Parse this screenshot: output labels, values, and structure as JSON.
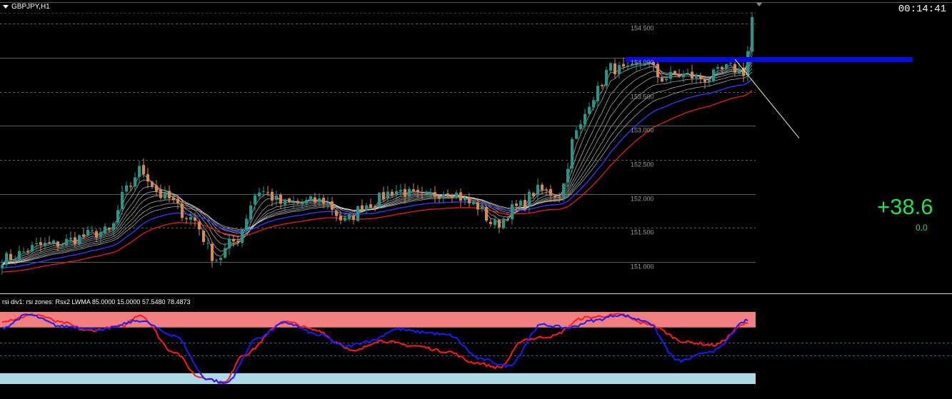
{
  "header": {
    "symbol": "GBPJPY,H1",
    "clock": "00:14:41"
  },
  "panel": {
    "value_big": "+38.6",
    "value_small": "0.0"
  },
  "subwindow": {
    "label": "rsi div1: rsi zones: Rsx2 LWMA 85.0000 15.0000 57.5480 78.4873"
  },
  "colors": {
    "background": "#000000",
    "bull": "#1e9a8a",
    "bear": "#d88a4e",
    "ma_red": "#e02020",
    "ma_blue": "#3a3aff",
    "resistance": "#0a0ae6",
    "upper_zone": "#f08080",
    "lower_zone": "#add8e6",
    "rsi_red": "#ff1a1a",
    "rsi_blue": "#1a1aff",
    "value_green": "#22e04e"
  },
  "chart_data": [
    {
      "type": "candlestick",
      "title": "GBPJPY,H1",
      "y_ticks": [
        "154.500",
        "154.000",
        "153.500",
        "153.000",
        "152.500",
        "152.000",
        "151.500",
        "151.000"
      ],
      "ylim": [
        150.55,
        154.85
      ],
      "n_bars": 176,
      "close_anchors": [
        [
          0,
          151.05
        ],
        [
          10,
          151.25
        ],
        [
          25,
          151.45
        ],
        [
          29,
          152.05
        ],
        [
          32,
          152.35
        ],
        [
          38,
          151.95
        ],
        [
          44,
          151.65
        ],
        [
          50,
          151.05
        ],
        [
          54,
          151.3
        ],
        [
          60,
          152.05
        ],
        [
          66,
          151.85
        ],
        [
          75,
          151.9
        ],
        [
          80,
          151.6
        ],
        [
          85,
          151.85
        ],
        [
          92,
          152.05
        ],
        [
          98,
          151.95
        ],
        [
          104,
          152.05
        ],
        [
          110,
          151.85
        ],
        [
          115,
          151.55
        ],
        [
          120,
          151.8
        ],
        [
          125,
          152.05
        ],
        [
          130,
          152.0
        ],
        [
          134,
          152.9
        ],
        [
          138,
          153.45
        ],
        [
          142,
          153.85
        ],
        [
          146,
          153.8
        ],
        [
          150,
          153.95
        ],
        [
          154,
          153.7
        ],
        [
          158,
          153.75
        ],
        [
          164,
          153.7
        ],
        [
          170,
          153.85
        ],
        [
          173,
          153.8
        ],
        [
          174,
          154.1
        ],
        [
          175,
          154.6
        ]
      ],
      "resistance_level": 153.98,
      "trendline": {
        "from": [
          171,
          153.98
        ],
        "to": [
          186,
          152.82
        ]
      },
      "moving_average_series": [
        "ma_red",
        "ma_blue",
        "ma_white_1",
        "ma_white_2",
        "ma_white_3",
        "ma_white_4",
        "ma_white_5",
        "ma_white_6",
        "ma_white_7",
        "ma_white_8"
      ]
    },
    {
      "type": "line",
      "title": "rsi div1: rsi zones: Rsx2 LWMA 85.0000 15.0000 57.5480 78.4873",
      "ylim": [
        0,
        100
      ],
      "zones": {
        "upper": [
          78.4873,
          100
        ],
        "lower": [
          0,
          15
        ]
      },
      "levels": [
        57.548,
        40
      ],
      "series": [
        {
          "color": "rsi_red",
          "points": [
            [
              0,
              88
            ],
            [
              8,
              96
            ],
            [
              14,
              85
            ],
            [
              20,
              74
            ],
            [
              28,
              80
            ],
            [
              32,
              96
            ],
            [
              40,
              45
            ],
            [
              46,
              10
            ],
            [
              52,
              2
            ],
            [
              56,
              40
            ],
            [
              66,
              86
            ],
            [
              74,
              74
            ],
            [
              78,
              58
            ],
            [
              82,
              45
            ],
            [
              88,
              60
            ],
            [
              96,
              53
            ],
            [
              104,
              45
            ],
            [
              110,
              30
            ],
            [
              116,
              23
            ],
            [
              122,
              62
            ],
            [
              128,
              66
            ],
            [
              136,
              92
            ],
            [
              144,
              96
            ],
            [
              150,
              84
            ],
            [
              160,
              58
            ],
            [
              166,
              54
            ],
            [
              174,
              84
            ]
          ]
        },
        {
          "color": "rsi_blue",
          "points": [
            [
              0,
              78
            ],
            [
              6,
              96
            ],
            [
              14,
              80
            ],
            [
              24,
              76
            ],
            [
              32,
              88
            ],
            [
              40,
              68
            ],
            [
              48,
              7
            ],
            [
              52,
              1
            ],
            [
              60,
              65
            ],
            [
              66,
              85
            ],
            [
              74,
              68
            ],
            [
              80,
              52
            ],
            [
              86,
              60
            ],
            [
              92,
              76
            ],
            [
              98,
              72
            ],
            [
              104,
              68
            ],
            [
              112,
              34
            ],
            [
              118,
              25
            ],
            [
              126,
              82
            ],
            [
              132,
              78
            ],
            [
              138,
              88
            ],
            [
              144,
              96
            ],
            [
              150,
              88
            ],
            [
              158,
              32
            ],
            [
              166,
              46
            ],
            [
              174,
              88
            ]
          ]
        }
      ]
    }
  ]
}
